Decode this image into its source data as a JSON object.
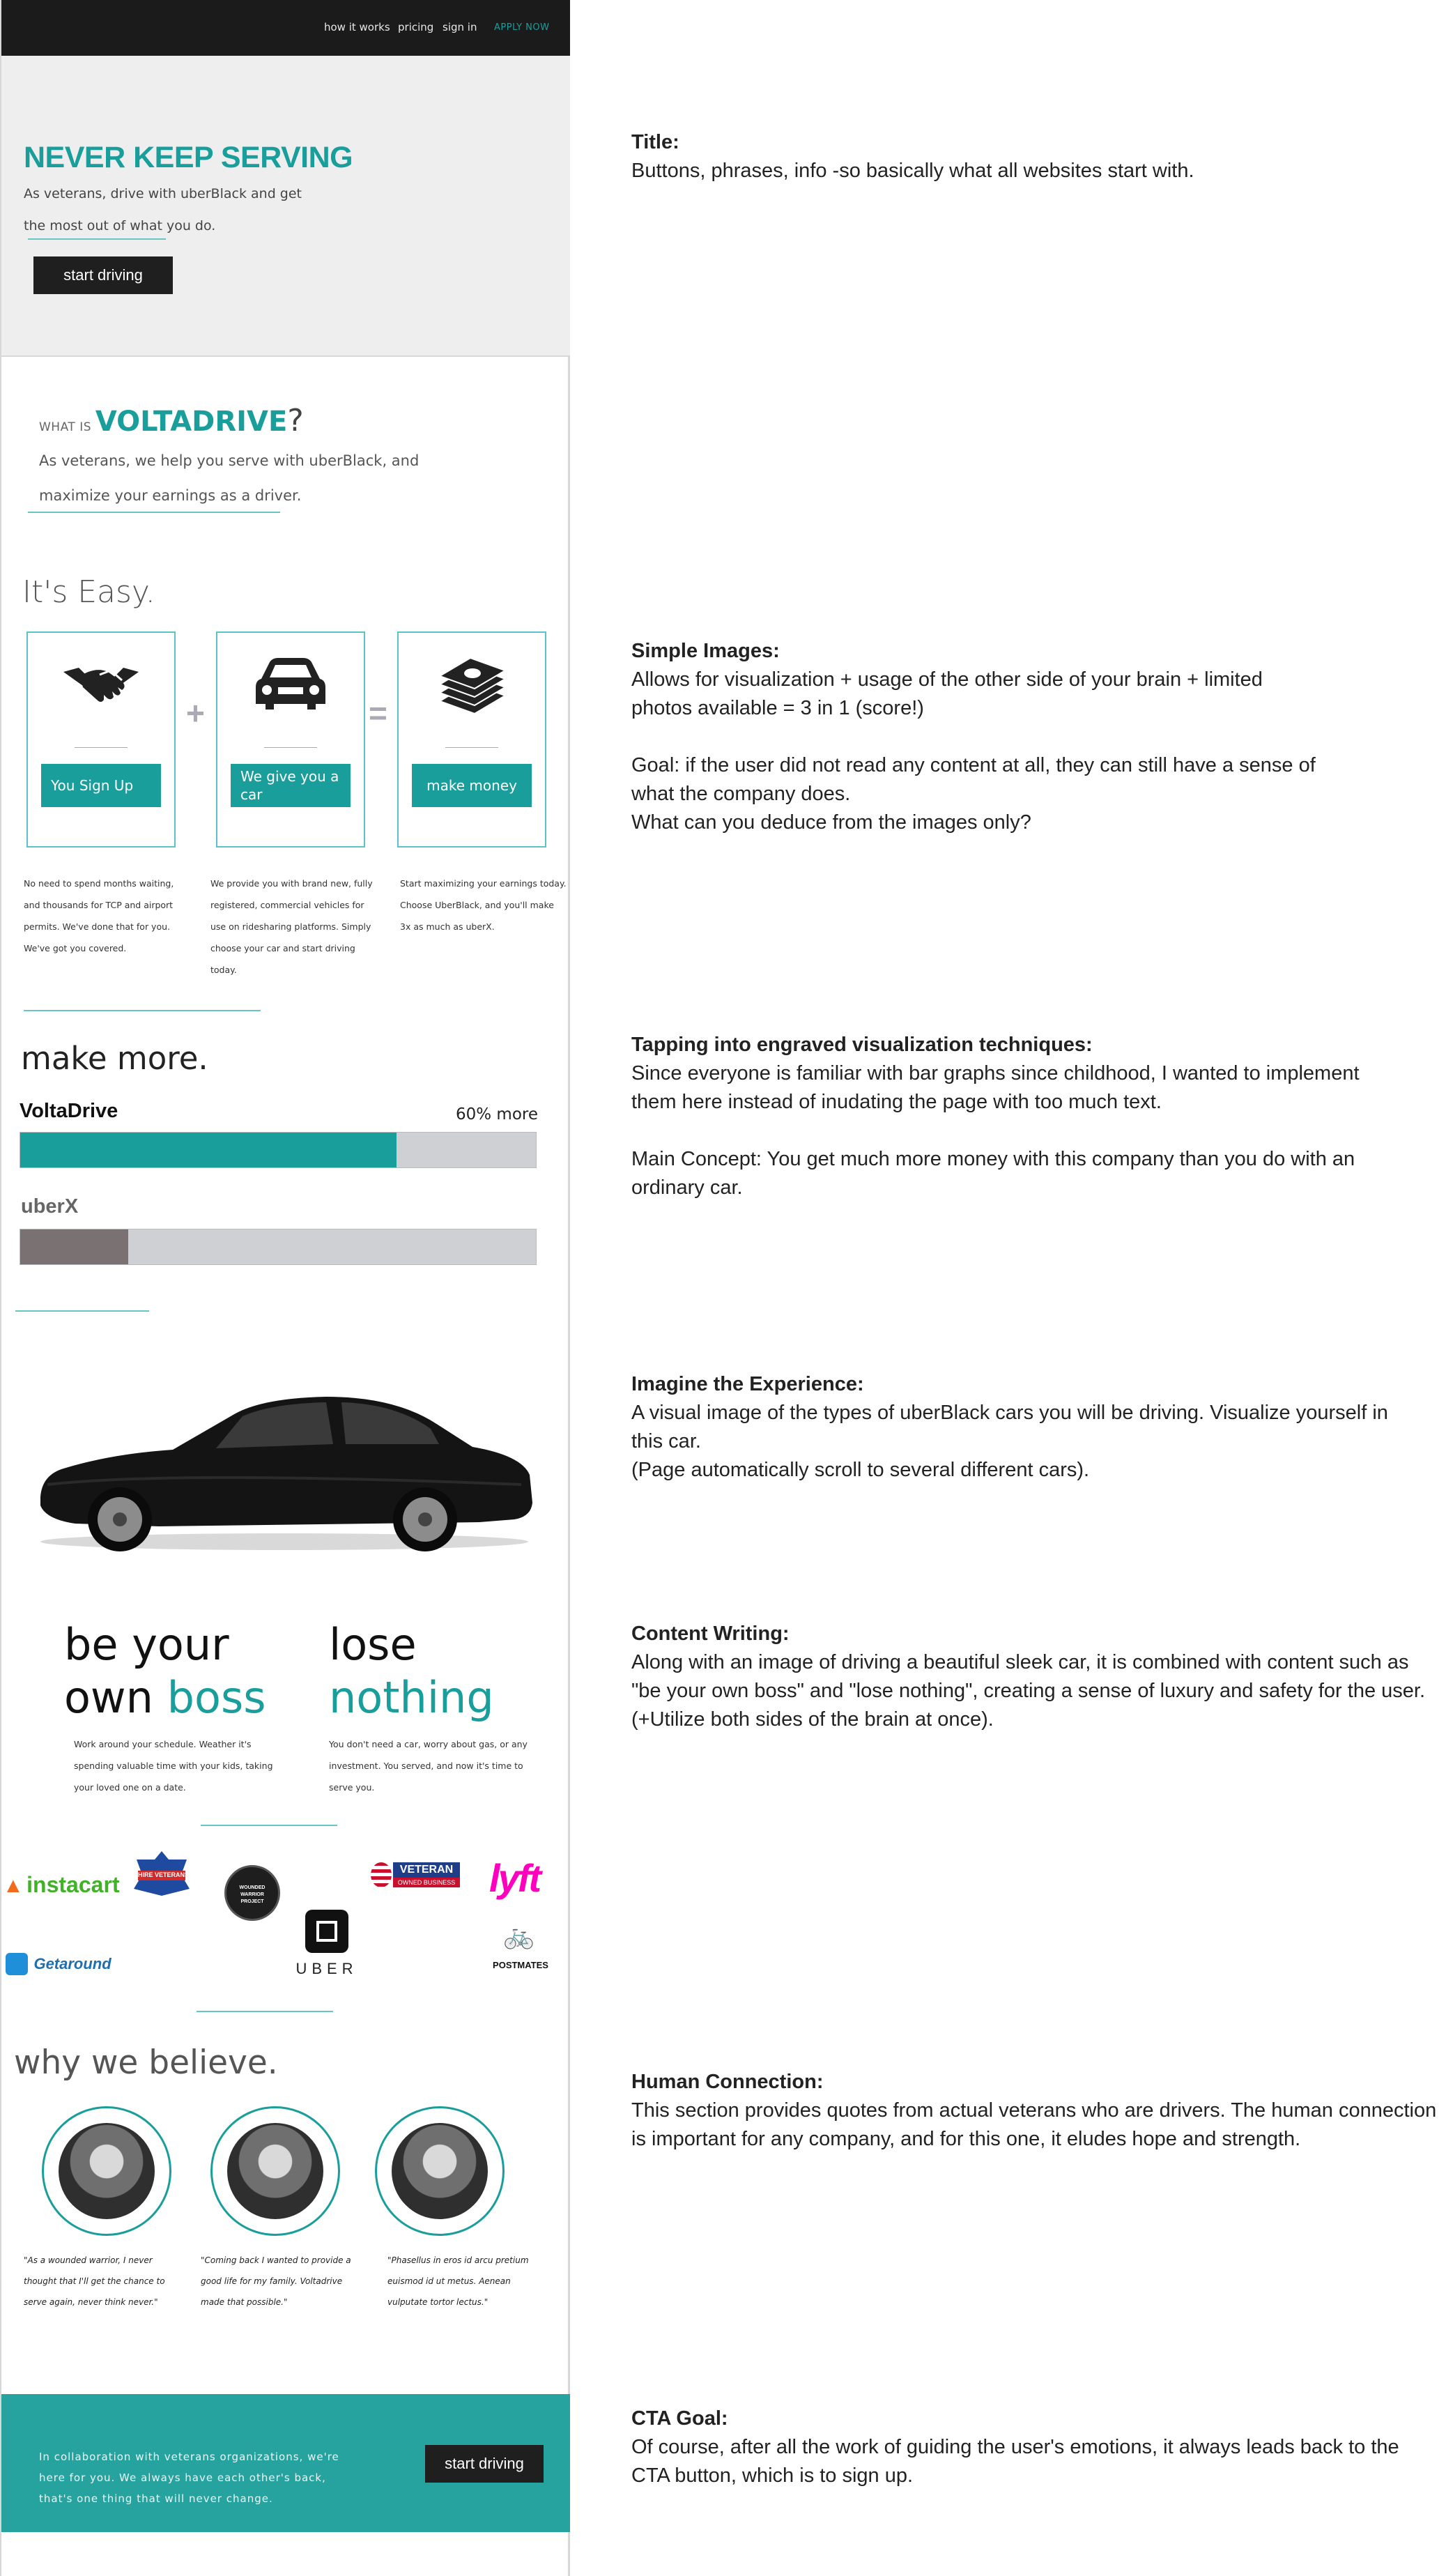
{
  "nav": {
    "links": [
      "how it works",
      "pricing",
      "sign in"
    ],
    "apply": "APPLY NOW"
  },
  "hero": {
    "title": "NEVER KEEP SERVING",
    "subtitle": "As veterans, drive with uberBlack and get the most out of what you do.",
    "button": "start driving"
  },
  "what": {
    "prefix": "WHAT IS ",
    "brand": "VOLTADRIVE",
    "suffix": "?",
    "text": "As veterans, we help you serve with uberBlack, and maximize your earnings as a driver."
  },
  "easy": {
    "title": "It's Easy.",
    "cards": [
      {
        "icon": "handshake-icon",
        "button": "You Sign Up",
        "desc": "No need to spend months waiting, and thousands for TCP and airport permits. We've done that for you. We've got you covered."
      },
      {
        "icon": "car-icon",
        "button": "We give you a car",
        "desc": "We provide you with brand new, fully registered, commercial vehicles for use on ridesharing platforms. Simply choose your car and start driving today."
      },
      {
        "icon": "money-stack-icon",
        "button": "make money",
        "desc": "Start maximizing your earnings today. Choose UberBlack, and you'll make 3x as much as uberX."
      }
    ],
    "operators": [
      "+",
      "="
    ]
  },
  "make": {
    "title": "make more.",
    "bars": [
      {
        "label": "VoltaDrive",
        "fraction": 0.73,
        "color": "#1a9e9b",
        "labelColor": "#111111"
      },
      {
        "label": "uberX",
        "fraction": 0.21,
        "color": "#7a7173",
        "labelColor": "#666666"
      }
    ],
    "note": "60% more"
  },
  "phrases": {
    "left": {
      "line1": "be your",
      "line2a": "own ",
      "line2b": "boss",
      "desc": "Work around your schedule. Weather it's spending valuable time with your kids, taking your loved one on a date."
    },
    "right": {
      "line1": "lose",
      "line2": "nothing",
      "desc": "You don't need a car, worry about gas, or any investment. You served, and now it's time to serve you."
    }
  },
  "logos": {
    "instacart": "instacart",
    "hire": "I HIRE VETERANS",
    "wounded": "WOUNDED WARRIOR PROJECT",
    "veteran": "VETERAN",
    "veteran_sub": "OWNED BUSINESS",
    "lyft": "lyft",
    "uber": "UBER",
    "postmates": "POSTMATES",
    "getaround": "Getaround"
  },
  "why": {
    "title": "why we believe.",
    "quotes": [
      "\"As a wounded warrior, I never thought that I'll get the chance to serve again, never think never.\"",
      "\"Coming back I wanted to provide a good life for my family. Voltadrive made that possible.\"",
      "\"Phasellus in eros id arcu pretium euismod id ut metus. Aenean vulputate tortor lectus.\""
    ]
  },
  "cta": {
    "text": "In collaboration with veterans organizations, we're here for you. We always have each other's back, that's one thing that will never change.",
    "button": "start driving"
  },
  "notes": [
    {
      "title": "Title:",
      "lines": [
        "Buttons, phrases, info -so basically what all websites start with."
      ]
    },
    {
      "title": "Simple Images:",
      "lines": [
        "Allows for visualization + usage of the other side of your brain + limited photos available = 3 in 1 (score!)",
        "",
        "Goal: if the user did not read any content at all, they can still have a sense of what the company does.",
        "What can you deduce from the images only?"
      ]
    },
    {
      "title": "Tapping into engraved visualization techniques:",
      "lines": [
        "Since everyone is familiar with bar graphs since childhood, I wanted to implement them here instead of inudating the page with too much text.",
        "",
        "Main Concept: You get much more money with this company than you do with an ordinary car."
      ]
    },
    {
      "title": "Imagine the Experience:",
      "lines": [
        "A visual image of the types of uberBlack cars you will be driving. Visualize yourself in this car.",
        "(Page automatically scroll to several different cars)."
      ]
    },
    {
      "title": "Content Writing:",
      "lines": [
        "Along with an image of driving a beautiful sleek car, it is combined with content such as \"be your own boss\" and \"lose nothing\", creating a sense of luxury and safety for the user. (+Utilize both sides of the brain at once)."
      ]
    },
    {
      "title": "Human Connection:",
      "lines": [
        "This section provides quotes from actual veterans who are drivers. The human connection is important for any company, and for this one, it eludes hope and strength."
      ]
    },
    {
      "title": "CTA Goal:",
      "lines": [
        "Of course, after all the work of guiding the user's emotions, it always leads back to the CTA button, which is to sign up."
      ]
    }
  ]
}
